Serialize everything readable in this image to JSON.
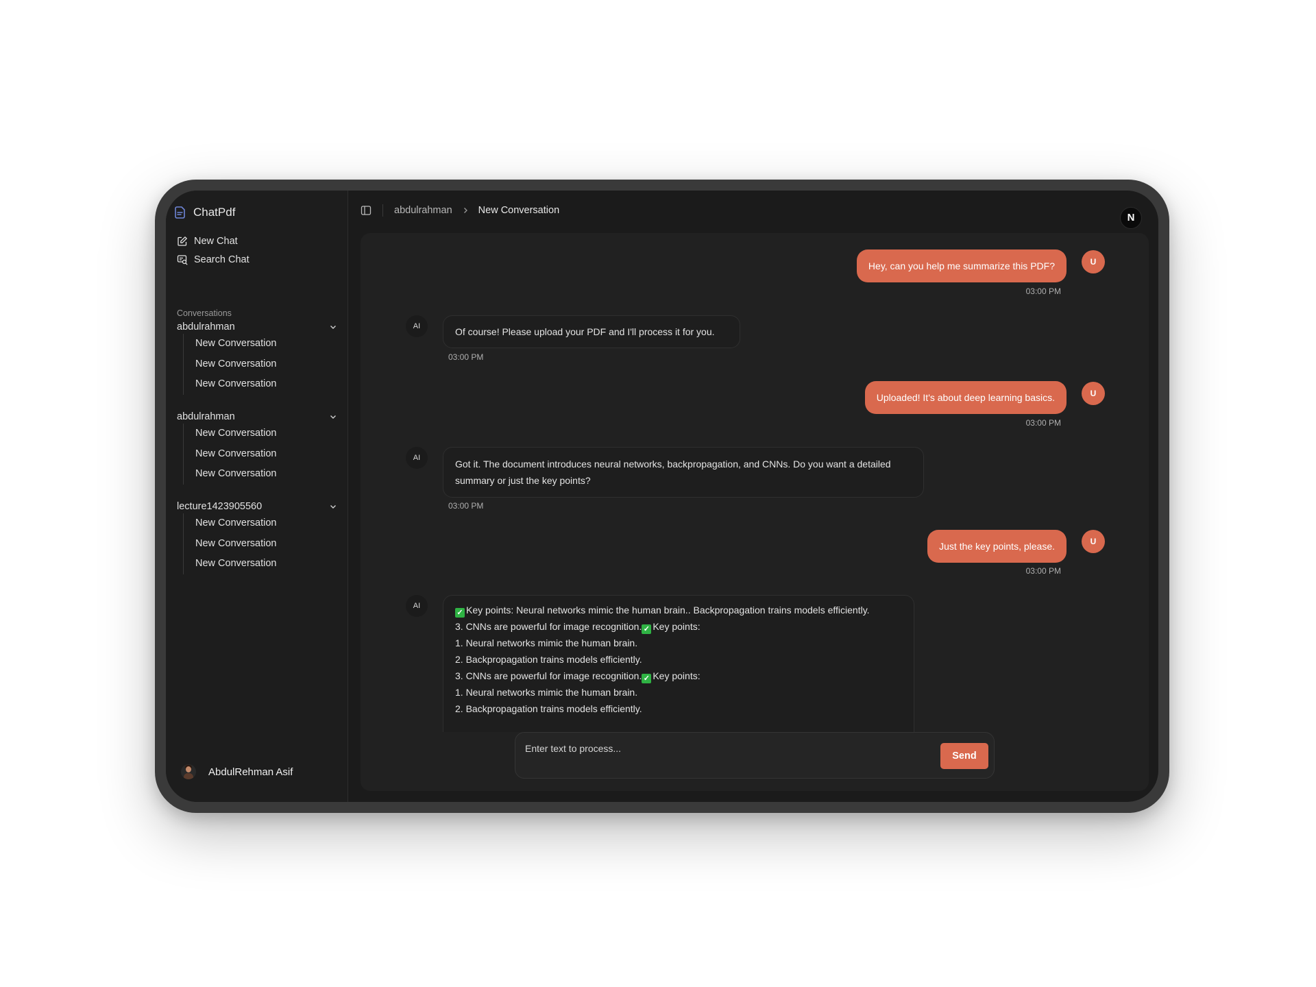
{
  "app": {
    "title": "ChatPdf"
  },
  "sidebar": {
    "new_chat": "New Chat",
    "search_chat": "Search Chat",
    "section_label": "Conversations",
    "groups": [
      {
        "name": "abdulrahman",
        "items": [
          "New Conversation",
          "New Conversation",
          "New Conversation"
        ]
      },
      {
        "name": "abdulrahman",
        "items": [
          "New Conversation",
          "New Conversation",
          "New Conversation"
        ]
      },
      {
        "name": "lecture1423905560",
        "items": [
          "New Conversation",
          "New Conversation",
          "New Conversation"
        ]
      }
    ],
    "user_name": "AbdulRehman Asif"
  },
  "header": {
    "breadcrumb_parent": "abdulrahman",
    "breadcrumb_current": "New Conversation",
    "badge": "N"
  },
  "messages": [
    {
      "role": "user",
      "avatar": "U",
      "text": "Hey, can you help me summarize this PDF?",
      "time": "03:00 PM"
    },
    {
      "role": "ai",
      "avatar": "AI",
      "text": "Of course! Please upload your PDF and I'll process it for you.",
      "time": "03:00 PM"
    },
    {
      "role": "user",
      "avatar": "U",
      "text": "Uploaded! It's about deep learning basics.",
      "time": "03:00 PM"
    },
    {
      "role": "ai",
      "avatar": "AI",
      "text": "Got it. The document introduces neural networks, backpropagation, and CNNs. Do you want a detailed summary or just the key points?",
      "time": "03:00 PM"
    },
    {
      "role": "user",
      "avatar": "U",
      "text": "Just the key points, please.",
      "time": "03:00 PM"
    },
    {
      "role": "ai",
      "avatar": "AI",
      "lines": [
        "Key points: Neural networks mimic the human brain.. Backpropagation trains models efficiently.",
        "3. CNNs are powerful for image recognition.",
        "Key points:",
        "1. Neural networks mimic the human brain.",
        "2. Backpropagation trains models efficiently.",
        "3. CNNs are powerful for image recognition.",
        "Key points:",
        "1. Neural networks mimic the human brain.",
        "2. Backpropagation trains models efficiently."
      ]
    }
  ],
  "composer": {
    "placeholder": "Enter text to process...",
    "send_label": "Send"
  },
  "colors": {
    "accent": "#d9694e",
    "background": "#1b1b1b",
    "chat_panel": "#212121",
    "check": "#2fb344"
  },
  "icons": {
    "brand": "document-icon",
    "new_chat": "edit-icon",
    "search_chat": "search-chat-icon",
    "toggle_sidebar": "sidebar-toggle-icon",
    "chevron": "chevron-down-icon",
    "breadcrumb_sep": "chevron-right-icon"
  }
}
